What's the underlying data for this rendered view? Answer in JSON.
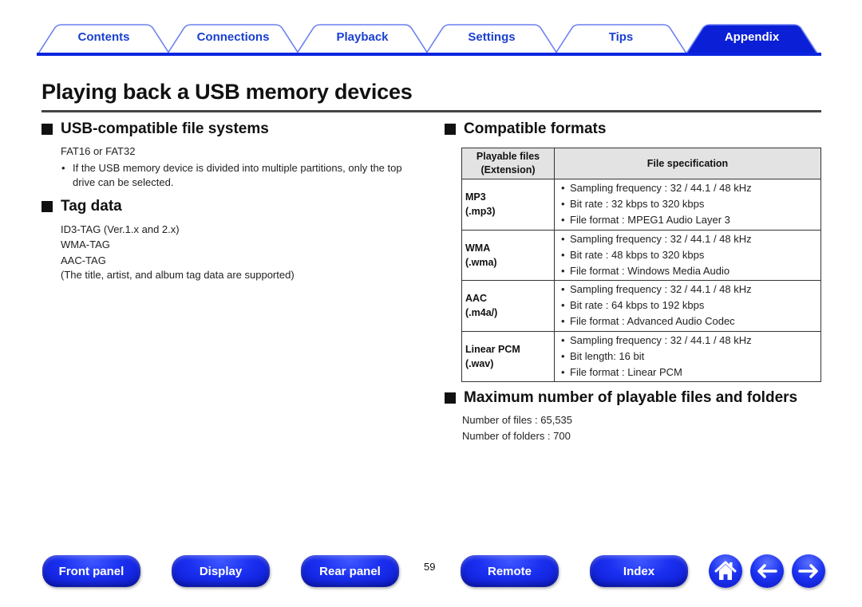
{
  "tabs": [
    {
      "label": "Contents",
      "active": false
    },
    {
      "label": "Connections",
      "active": false
    },
    {
      "label": "Playback",
      "active": false
    },
    {
      "label": "Settings",
      "active": false
    },
    {
      "label": "Tips",
      "active": false
    },
    {
      "label": "Appendix",
      "active": true
    }
  ],
  "colors": {
    "accent": "#0a25e0",
    "tab_text": "#1a3fd0",
    "button_blue": "#1a2ff0",
    "table_header_bg": "#e3e3e3"
  },
  "page": {
    "title": "Playing back a USB memory devices",
    "number": "59"
  },
  "sections": {
    "file_systems": {
      "heading": "USB-compatible file systems",
      "text": "FAT16 or FAT32",
      "note": "If the USB memory device is divided into multiple partitions, only the top drive can be selected."
    },
    "tag_data": {
      "heading": "Tag data",
      "lines": [
        "ID3-TAG (Ver.1.x and 2.x)",
        "WMA-TAG",
        "AAC-TAG",
        "(The title, artist, and album tag data are supported)"
      ]
    },
    "formats": {
      "heading": "Compatible formats",
      "header": {
        "col1_line1": "Playable files",
        "col1_line2": "(Extension)",
        "col2": "File specification"
      },
      "rows": [
        {
          "name": "MP3",
          "ext": "(.mp3)",
          "specs": [
            "Sampling frequency : 32 / 44.1 / 48 kHz",
            "Bit rate : 32 kbps to 320 kbps",
            "File format : MPEG1 Audio Layer 3"
          ]
        },
        {
          "name": "WMA",
          "ext": "(.wma)",
          "specs": [
            "Sampling frequency : 32 / 44.1 / 48 kHz",
            "Bit rate : 48 kbps to 320 kbps",
            "File format : Windows Media Audio"
          ]
        },
        {
          "name": "AAC",
          "ext": "(.m4a/)",
          "specs": [
            "Sampling frequency : 32 / 44.1 / 48 kHz",
            "Bit rate : 64 kbps to 192 kbps",
            "File format : Advanced Audio Codec"
          ]
        },
        {
          "name": "Linear PCM",
          "ext": "(.wav)",
          "specs": [
            "Sampling frequency : 32 / 44.1 / 48 kHz",
            "Bit length: 16 bit",
            "File format : Linear PCM"
          ]
        }
      ]
    },
    "max_files": {
      "heading": "Maximum number of playable files and folders",
      "files": "Number of files : 65,535",
      "folders": "Number of folders : 700"
    }
  },
  "bottom_nav": {
    "buttons": [
      "Front panel",
      "Display",
      "Rear panel",
      "Remote",
      "Index"
    ],
    "icons": [
      "home-icon",
      "arrow-left-icon",
      "arrow-right-icon"
    ]
  }
}
